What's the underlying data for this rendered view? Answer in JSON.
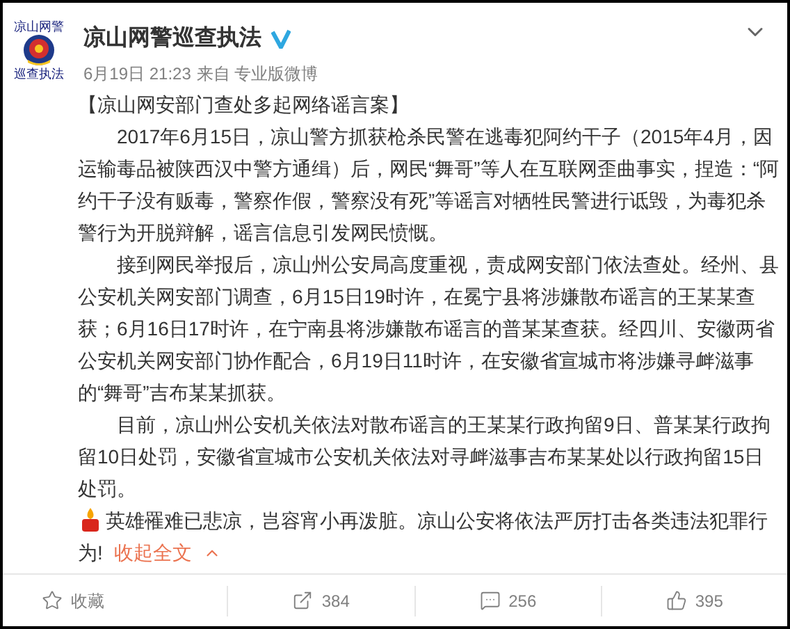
{
  "author": {
    "avatar_top": "凉山网警",
    "avatar_bottom": "巡查执法",
    "name": "凉山网警巡查执法",
    "verified": true,
    "time": "6月19日 21:23",
    "source": "来自 专业版微博"
  },
  "post": {
    "title": "【凉山网安部门查处多起网络谣言案】",
    "paragraphs": [
      {
        "kind": "indent",
        "text": "2017年6月15日，凉山警方抓获枪杀民警在逃毒犯阿约干子（2015年4月，因运输毒品被陕西汉中警方通缉）后，网民“舞哥”等人在互联网歪曲事实，捏造：“阿约干子没有贩毒，警察作假，警察没有死”等谣言对牺牲民警进行诋毁，为毒犯杀警行为开脱辩解，谣言信息引发网民愤慨。"
      },
      {
        "kind": "indent",
        "text": "接到网民举报后，凉山州公安局高度重视，责成网安部门依法查处。经州、县公安机关网安部门调查，6月15日19时许，在冕宁县将涉嫌散布谣言的王某某查获；6月16日17时许，在宁南县将涉嫌散布谣言的普某某查获。经四川、安徽两省公安机关网安部门协作配合，6月19日11时许，在安徽省宣城市将涉嫌寻衅滋事的“舞哥”吉布某某抓获。"
      },
      {
        "kind": "indent",
        "text": "目前，凉山州公安机关依法对散布谣言的王某某行政拘留9日、普某某行政拘留10日处罚，安徽省宣城市公安机关依法对寻衅滋事吉布某某处以行政拘留15日处罚。"
      },
      {
        "kind": "candle",
        "text": "英雄罹难已悲凉，岂容宵小再泼脏。凉山公安将依法严厉打击各类违法犯罪行为!"
      }
    ],
    "collapse_link": "收起全文"
  },
  "actions": [
    {
      "kind": "favorite",
      "label": "收藏"
    },
    {
      "kind": "share",
      "label": "384"
    },
    {
      "kind": "comment",
      "label": "256"
    },
    {
      "kind": "like",
      "label": "395"
    }
  ]
}
